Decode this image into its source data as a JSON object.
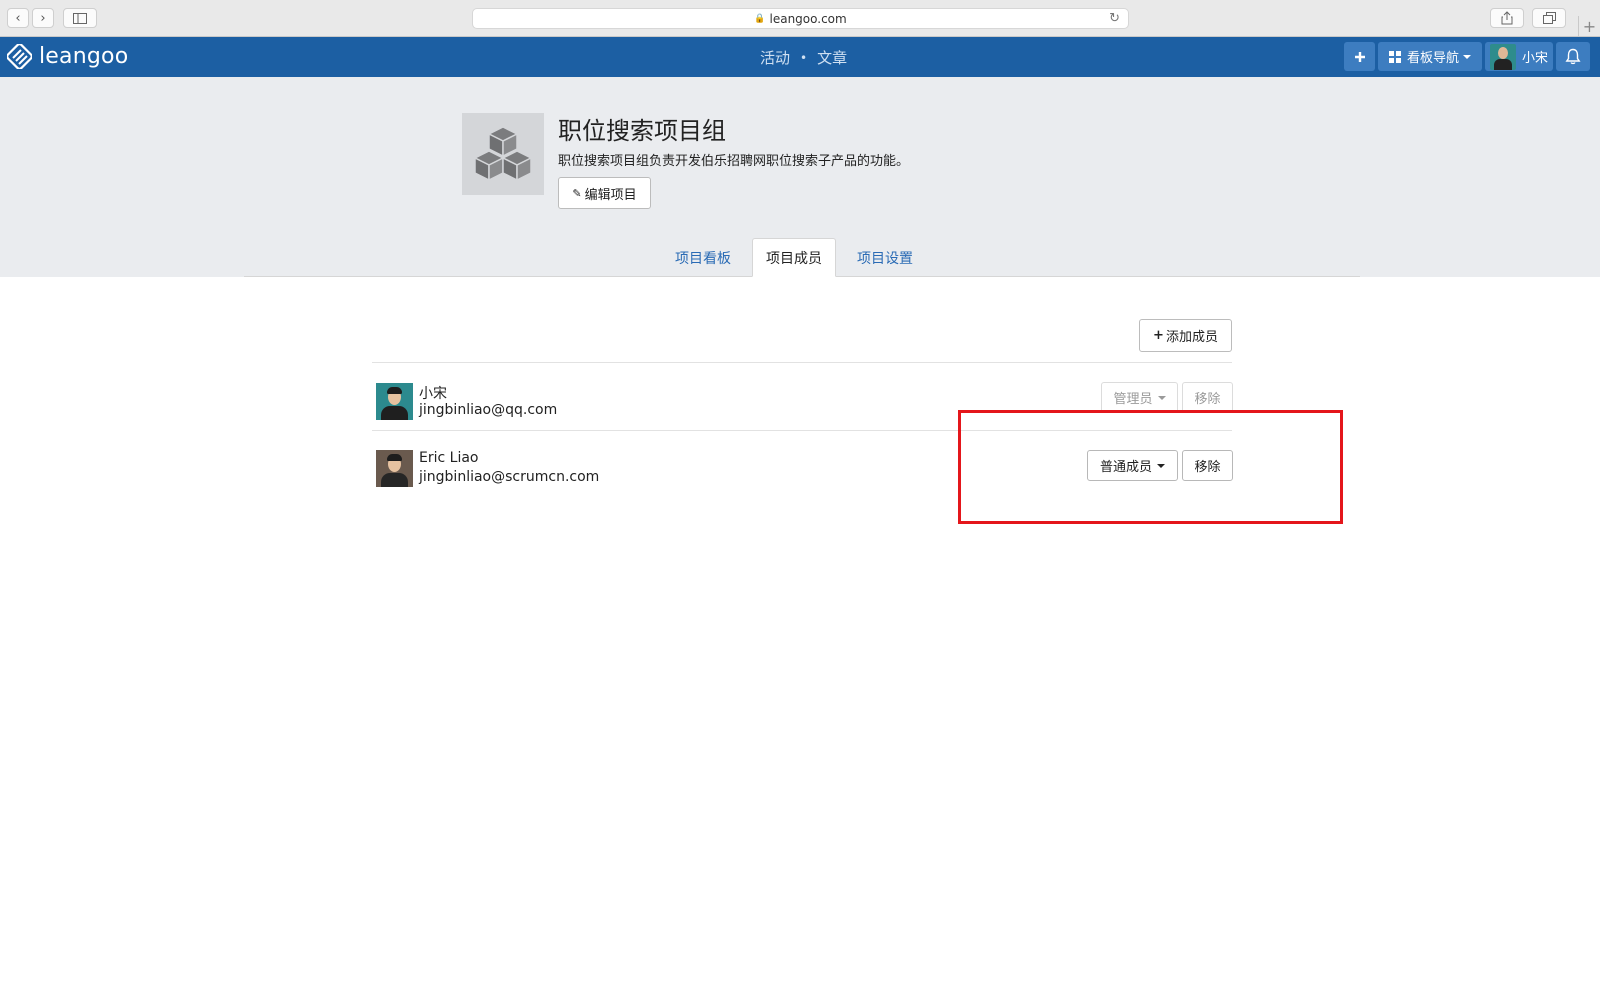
{
  "browser": {
    "url": "leangoo.com"
  },
  "navbar": {
    "logo_text": "leangoo",
    "links": [
      "活动",
      "文章"
    ],
    "dot": "•",
    "add_icon": "plus-icon",
    "board_nav_label": "看板导航",
    "user_name": "小宋",
    "bell_icon": "bell-icon",
    "brand_color": "#1c5fa3"
  },
  "project": {
    "title": "职位搜索项目组",
    "description": "职位搜索项目组负责开发伯乐招聘网职位搜索子产品的功能。",
    "edit_label": "编辑项目"
  },
  "tabs": [
    {
      "label": "项目看板",
      "active": false
    },
    {
      "label": "项目成员",
      "active": true
    },
    {
      "label": "项目设置",
      "active": false
    }
  ],
  "members": {
    "add_label": "添加成员",
    "list": [
      {
        "name": "小宋",
        "email": "jingbinliao@qq.com",
        "role": "管理员",
        "remove": "移除",
        "enabled": false
      },
      {
        "name": "Eric Liao",
        "email": "jingbinliao@scrumcn.com",
        "role": "普通成员",
        "remove": "移除",
        "enabled": true
      }
    ]
  },
  "annotation": {
    "highlight_color": "#e4161b"
  }
}
